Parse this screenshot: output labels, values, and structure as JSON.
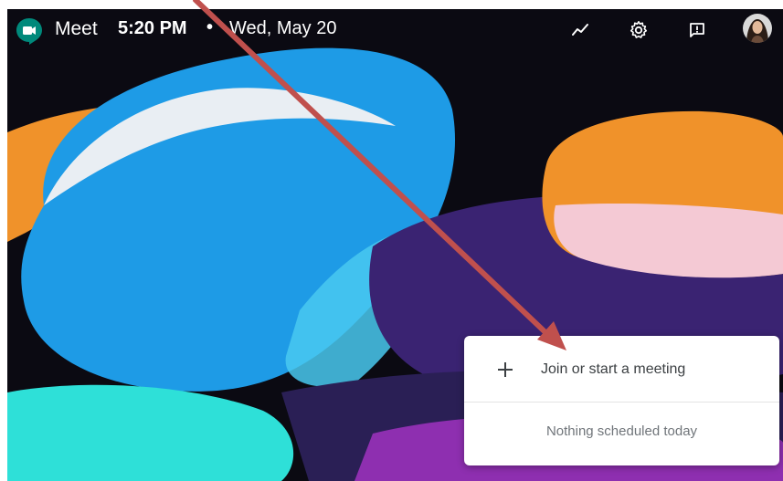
{
  "header": {
    "app_name": "Meet",
    "time": "5:20 PM",
    "separator": "•",
    "date": "Wed, May 20",
    "icons": [
      "activity-icon",
      "gear-icon",
      "feedback-icon",
      "avatar"
    ]
  },
  "meeting_card": {
    "join_label": "Join or start a meeting",
    "empty_state": "Nothing scheduled today",
    "plus_icon": "plus-icon"
  },
  "colors": {
    "background": "#0b0a12",
    "blue": "#1e9be6",
    "orange": "#f0922a",
    "cyan": "#2ee0d8",
    "purple": "#4a2a8a",
    "annotation_arrow": "#c0504d",
    "meet_green": "#00897b"
  }
}
